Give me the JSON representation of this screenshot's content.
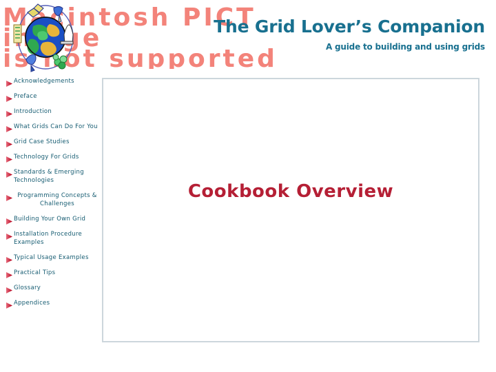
{
  "header": {
    "title": "The Grid Lover’s Companion",
    "subtitle": "A guide to building and using grids",
    "placeholder": {
      "line1": "Macintosh PICT",
      "line2": "image",
      "line3": "is not supported",
      "color": "#f3837a"
    },
    "logo_icon": "globe-grid-icon",
    "title_color": "#18708f"
  },
  "sidebar": {
    "items": [
      {
        "label": "Acknowledgements",
        "bullet_icon": "red-arrow-bullet-icon",
        "centered": false
      },
      {
        "label": "Preface",
        "bullet_icon": "red-arrow-bullet-icon",
        "centered": false
      },
      {
        "label": "Introduction",
        "bullet_icon": "red-arrow-bullet-icon",
        "centered": false
      },
      {
        "label": "What Grids Can Do For You",
        "bullet_icon": "red-arrow-bullet-icon",
        "centered": false
      },
      {
        "label": "Grid Case Studies",
        "bullet_icon": "red-arrow-bullet-icon",
        "centered": false
      },
      {
        "label": "Technology For Grids",
        "bullet_icon": "red-arrow-bullet-icon",
        "centered": false
      },
      {
        "label": "Standards & Emerging Technologies",
        "bullet_icon": "red-arrow-bullet-icon",
        "centered": false
      },
      {
        "label": "Programming Concepts & Challenges",
        "bullet_icon": "red-arrow-bullet-icon",
        "centered": true
      },
      {
        "label": "Building Your Own Grid",
        "bullet_icon": "red-arrow-bullet-icon",
        "centered": false
      },
      {
        "label": "Installation Procedure Examples",
        "bullet_icon": "red-arrow-bullet-icon",
        "centered": false
      },
      {
        "label": "Typical Usage Examples",
        "bullet_icon": "red-arrow-bullet-icon",
        "centered": false
      },
      {
        "label": "Practical Tips",
        "bullet_icon": "red-arrow-bullet-icon",
        "centered": false
      },
      {
        "label": "Glossary",
        "bullet_icon": "red-arrow-bullet-icon",
        "centered": false
      },
      {
        "label": "Appendices",
        "bullet_icon": "red-arrow-bullet-icon",
        "centered": false
      }
    ],
    "link_color": "#135a70",
    "bullet_color": "#c8102e"
  },
  "main": {
    "heading": "Cookbook Overview",
    "heading_color": "#b51f35",
    "border_color": "#ccd6dc"
  }
}
